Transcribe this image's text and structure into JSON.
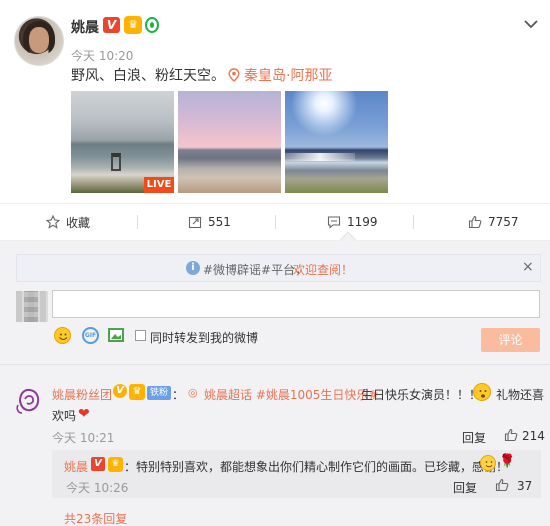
{
  "post": {
    "username": "姚晨",
    "verified_badge": "V",
    "time": "今天 10:20",
    "text": "野风、白浪、粉红天空。",
    "location": "秦皇岛·阿那亚",
    "live_label": "LIVE",
    "icons": [
      "avatar",
      "verified-badge",
      "crown-badge",
      "shield-badge",
      "chevron-down-icon",
      "location-pin-icon"
    ]
  },
  "actions": {
    "favorite_label": "收藏",
    "forward_count": "551",
    "comment_count": "1199",
    "like_count": "7757"
  },
  "comment_box": {
    "notice_prefix": "#微博辟谣#平台，",
    "notice_link": "欢迎查阅！",
    "notice_close": "×",
    "input_placeholder": "",
    "forward_checkbox_label": "同时转发到我的微博",
    "submit_label": "评论"
  },
  "comments": [
    {
      "user": "姚晨粉丝团",
      "v_badge": "V",
      "fan_tag": "铁粉",
      "colon": "：",
      "supertopic_icon": "◎",
      "link_text": "姚晨超话 #姚晨1005生日快乐#",
      "text_part1": "生日快乐女演员！！！",
      "text_part2": "礼物还喜",
      "text_part3": "欢吗",
      "time": "今天 10:21",
      "reply_label": "回复",
      "likes": "214"
    }
  ],
  "reply": {
    "user": "姚晨",
    "v_badge": "V",
    "text": "：特别特别喜欢，都能想象出你们精心制作它们的画面。已珍藏，感谢！",
    "time": "今天 10:26",
    "reply_label": "回复",
    "likes": "37"
  },
  "more_replies": "共23条回复",
  "colors": {
    "accent_orange": "#eb7350",
    "submit_disabled": "#fbbb9e",
    "comment_bg": "#f2f2f5"
  }
}
